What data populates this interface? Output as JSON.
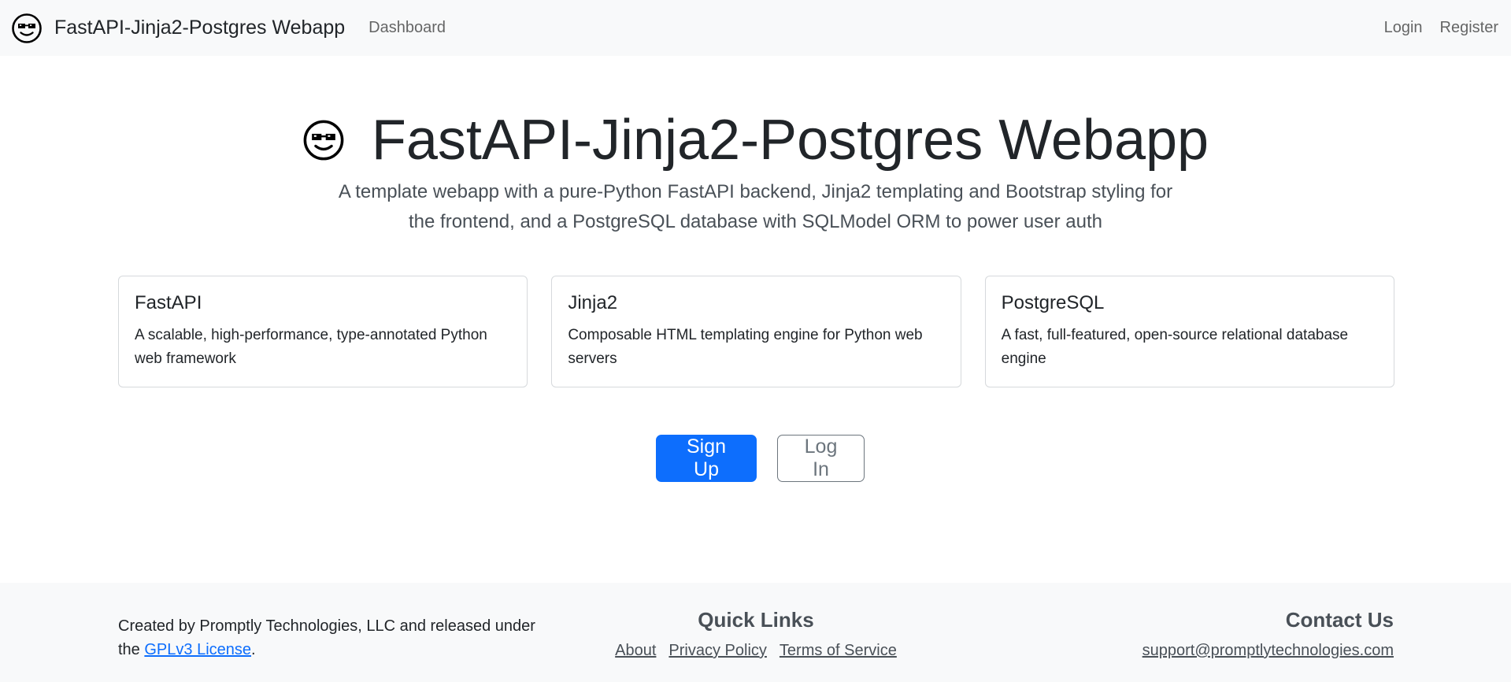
{
  "navbar": {
    "brand_icon": "sunglasses-face-icon",
    "brand_text": "FastAPI-Jinja2-Postgres Webapp",
    "dashboard_label": "Dashboard",
    "login_label": "Login",
    "register_label": "Register",
    "background": "#f8f9fa"
  },
  "hero": {
    "icon": "sunglasses-face-icon",
    "title": "FastAPI-Jinja2-Postgres Webapp",
    "subtitle": "A template webapp with a pure-Python FastAPI backend, Jinja2 templating and Bootstrap styling for the frontend, and a PostgreSQL database with SQLModel ORM to power user auth"
  },
  "cards": [
    {
      "title": "FastAPI",
      "text": "A scalable, high-performance, type-annotated Python web framework"
    },
    {
      "title": "Jinja2",
      "text": "Composable HTML templating engine for Python web servers"
    },
    {
      "title": "PostgreSQL",
      "text": "A fast, full-featured, open-source relational database engine"
    }
  ],
  "actions": {
    "signup_label": "Sign Up",
    "login_label": "Log In",
    "primary_color": "#0d6efd",
    "outline_color": "#6c757d"
  },
  "footer": {
    "created_text": "Created by Promptly Technologies, LLC and released under the",
    "license_link": "GPLv3 License",
    "period": ".",
    "quick_links_heading": "Quick Links",
    "links": [
      "About",
      "Privacy Policy",
      "Terms of Service"
    ],
    "contact_heading": "Contact Us",
    "email": "support@promptlytechnologies.com"
  }
}
